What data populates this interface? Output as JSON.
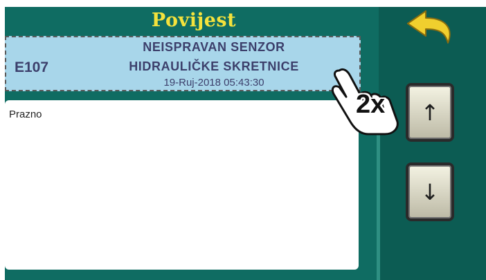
{
  "header": {
    "title": "Povijest"
  },
  "entry": {
    "code": "E107",
    "message_line1": "NEISPRAVAN SENZOR",
    "message_line2": "HIDRAULIČKE SKRETNICE",
    "timestamp": "19-Ruj-2018 05:43:30"
  },
  "details": {
    "text": "Prazno"
  },
  "controls": {
    "back_icon": "back-arrow-icon",
    "up_label": "↑",
    "down_label": "↓"
  },
  "annotation": {
    "tap_count": "2x"
  },
  "colors": {
    "screen_bg": "#0f6c62",
    "title": "#f4e23c",
    "entry_bg": "#a8d6ea",
    "entry_text": "#3c3f6b",
    "back_arrow": "#f0cf2e"
  }
}
